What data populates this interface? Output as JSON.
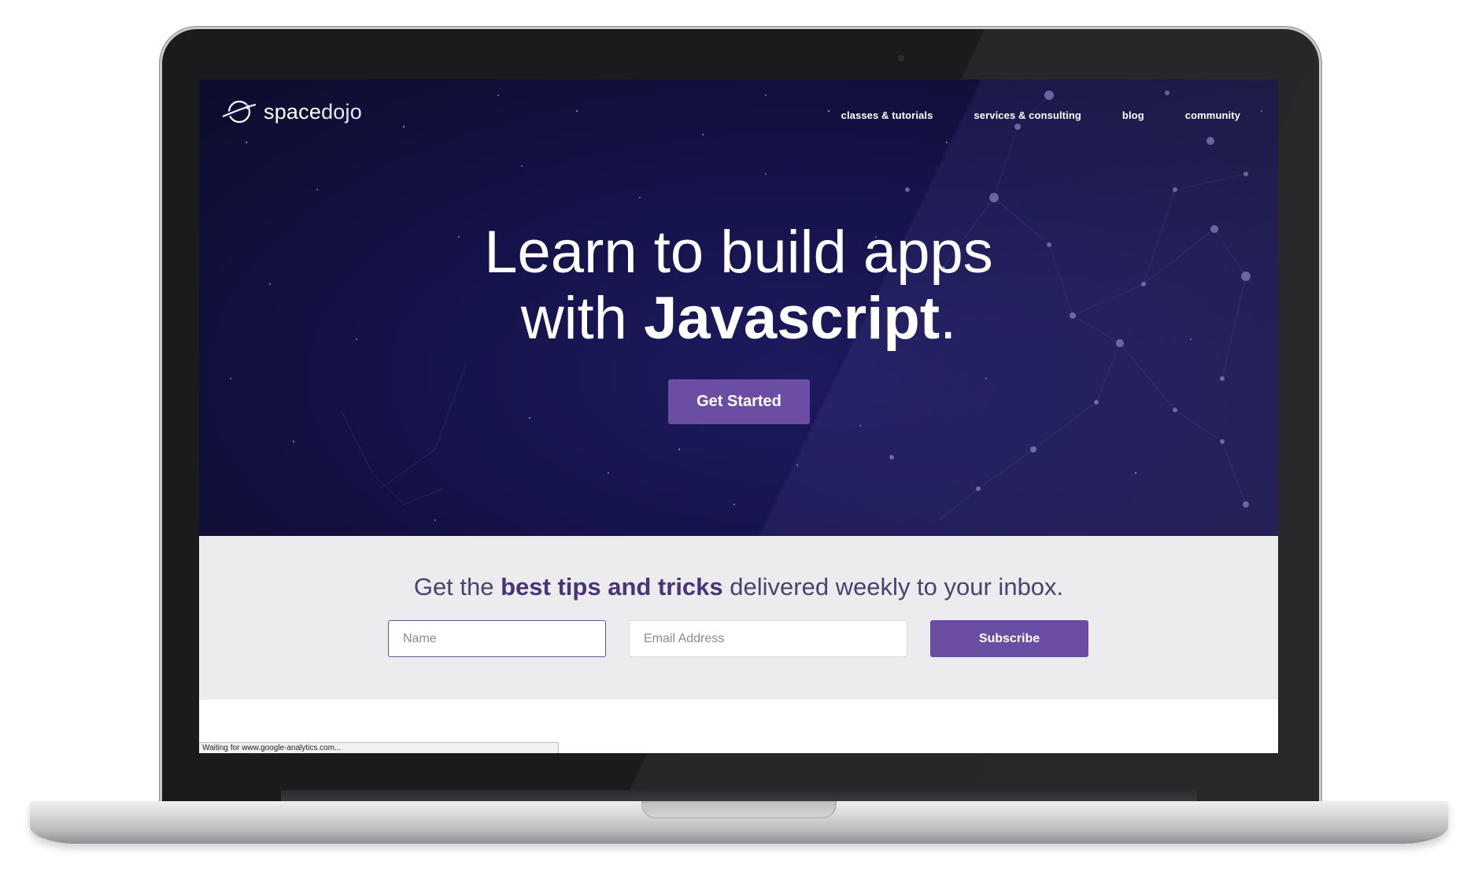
{
  "brand": {
    "name_part1": "space",
    "name_part2": "dojo"
  },
  "nav": {
    "items": [
      {
        "label": "classes & tutorials"
      },
      {
        "label": "services & consulting"
      },
      {
        "label": "blog"
      },
      {
        "label": "community"
      }
    ]
  },
  "hero": {
    "line1": "Learn to build apps",
    "line2_prefix": "with ",
    "line2_emphasis": "Javascript",
    "line2_suffix": ".",
    "cta_label": "Get Started"
  },
  "newsletter": {
    "text_prefix": "Get the ",
    "text_emphasis": "best tips and tricks",
    "text_suffix": " delivered weekly to your inbox.",
    "name_placeholder": "Name",
    "name_value": "",
    "email_placeholder": "Email Address",
    "email_value": "",
    "subscribe_label": "Subscribe"
  },
  "status_bar": {
    "text": "Waiting for www.google-analytics.com..."
  },
  "colors": {
    "accent": "#6b4ea3",
    "hero_bg": "#15134a",
    "newsletter_bg": "#ececee",
    "emphasis_text": "#4a3478"
  }
}
